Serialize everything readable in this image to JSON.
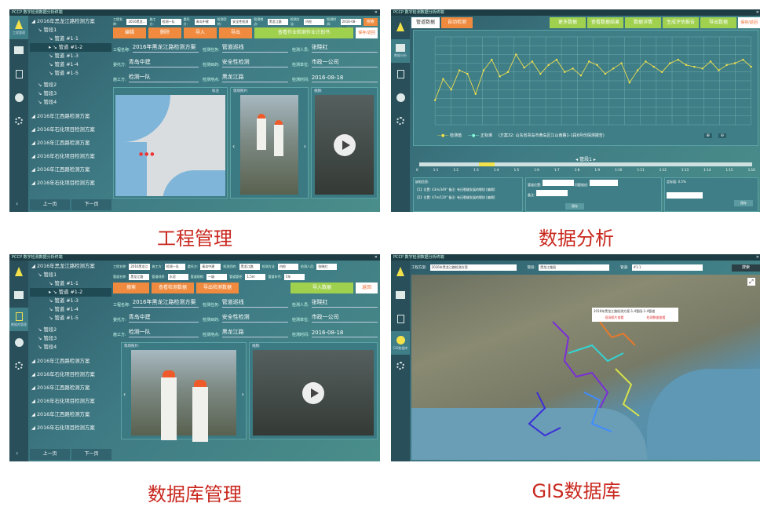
{
  "app_title": "PCCP 数字检测数据分析终端",
  "panels": {
    "p1": {
      "caption": "工程管理",
      "nav_label": "工程管理",
      "tree": {
        "root": "2016年黑龙江路检测方案",
        "seg": "管段1",
        "pipes": [
          "管道 #1-1",
          "管道 #1-2",
          "管道 #1-3",
          "管道 #1-4",
          "管道 #1-5"
        ],
        "segs": [
          "管段2",
          "管段3",
          "管段4"
        ],
        "projects": [
          "2016年江西路检测方案",
          "2016年石化项目检测方案",
          "2016年江西路检测方案",
          "2016年石化项目检测方案",
          "2016年江西路检测方案",
          "2016年石化项目检测方案"
        ]
      },
      "pager": {
        "prev": "上一页",
        "next": "下一页"
      },
      "filters": [
        "工程名称:",
        "2016黑龙...",
        "施工方:",
        "检测一队",
        "委托方:",
        "青岛中建",
        "检测目的:",
        "安全性检测",
        "检测地点:",
        "黑龙江路",
        "检测方法:",
        "内检",
        "检测时间:",
        "2016-08-18"
      ],
      "search": "搜索",
      "buttons": [
        "编辑",
        "删除",
        "导入",
        "导出"
      ],
      "green_button": "查看作业检测作业计划书",
      "white_button": "保存/返回",
      "info": [
        {
          "k": "工程名称:",
          "v": "2016年黑龙江路检测方案"
        },
        {
          "k": "检测任务:",
          "v": "管道巡线"
        },
        {
          "k": "检测人员:",
          "v": "张晓红"
        },
        {
          "k": "委托方:",
          "v": "青岛中建"
        },
        {
          "k": "检测目的:",
          "v": "安全性检测"
        },
        {
          "k": "检测单位:",
          "v": "市政一公司"
        },
        {
          "k": "施工方:",
          "v": "检测一队"
        },
        {
          "k": "检测地点:",
          "v": "黑龙江路"
        },
        {
          "k": "检测时间:",
          "v": "2016-08-18"
        }
      ],
      "media_labels": {
        "map": "标注",
        "photo": "现场照片:",
        "video": "视频:"
      }
    },
    "p2": {
      "caption": "数据分析",
      "nav_label": "数据分析",
      "top_select": "管道数据",
      "top_btn": "自动检测",
      "buttons": [
        "更多数据",
        "查看数据结果",
        "数据详情",
        "生成评估报告",
        "导出数据"
      ],
      "white_button": "保存/返回",
      "chart_note": "(方案32: 山东省青岛市黄岛区江山南路1-1段8月份探测报告)",
      "legend": [
        "检测值",
        "正标准"
      ],
      "segment_label": "管段1",
      "ticks": [
        "0",
        "1-1",
        "1-2",
        "1-3",
        "1-4",
        "1-5",
        "1-6",
        "1-7",
        "1-8",
        "1-9",
        "1-10",
        "1-11",
        "1-12",
        "1-13",
        "1-14",
        "1-15",
        "1-16"
      ],
      "bottom": {
        "left_title": "缺陷信息:",
        "left_rows": [
          "【1】位置: 43m/349°  备注: 有压裂缝发展的裂纹  [编辑]",
          "【2】位置: 47m/120°  备注: 有压裂缝发展的裂纹  [编辑]"
        ],
        "mid_labels": [
          "管道位置:",
          "问题描述:",
          "备注:"
        ],
        "mid_btn": "保存",
        "right_label": "定标值: 0.5%",
        "right_btn": "保存"
      }
    },
    "p3": {
      "caption": "数据库管理",
      "nav_label": "数据库管理",
      "buttons": [
        "搜索",
        "查看检测数据",
        "导出检测数据"
      ],
      "green_button": "导入数据",
      "white_button": "返回",
      "filters": [
        "工程名称:",
        "2016黑龙江",
        "施工方:",
        "检测一队",
        "委托方:",
        "青岛中建",
        "检测目的:",
        "黑龙江路",
        "检测方法:",
        "内检",
        "检测人员:",
        "张晓红",
        "管道名称:",
        "黑龙江路",
        "管道材质:",
        "水泥",
        "管道规格:",
        "一级",
        "管道管径:",
        "1.5m",
        "管道年代:",
        "5年"
      ],
      "info": [
        {
          "k": "工程名称:",
          "v": "2016年黑龙江路检测方案"
        },
        {
          "k": "检测任务:",
          "v": "管道巡线"
        },
        {
          "k": "检测人员:",
          "v": "张晓红"
        },
        {
          "k": "委托方:",
          "v": "青岛中建"
        },
        {
          "k": "检测目的:",
          "v": "安全性检测"
        },
        {
          "k": "检测单位:",
          "v": "市政一公司"
        },
        {
          "k": "施工方:",
          "v": "检测一队"
        },
        {
          "k": "检测地点:",
          "v": "黑龙江路"
        },
        {
          "k": "检测时间:",
          "v": "2016-08-18"
        }
      ],
      "media_labels": {
        "photo": "现场照片:",
        "video": "视频:"
      }
    },
    "p4": {
      "caption": "GIS数据库",
      "nav_label": "GIS数据库",
      "bar": [
        "工程方案:",
        "2016年黑龙江路检测方案",
        "管段:",
        "黑龙江路段",
        "管道:",
        "#1-1"
      ],
      "search": "搜索",
      "popup": [
        "2016年黑龙江路检测方案-1-4管段-1-4管道",
        "现场照片查看",
        "检测数据查看"
      ]
    }
  },
  "chart_data": {
    "type": "line",
    "title": "",
    "xlabel": "",
    "ylabel": "",
    "ylim": [
      0,
      100
    ],
    "series": [
      {
        "name": "检测值",
        "values": [
          28,
          52,
          40,
          62,
          58,
          35,
          62,
          74,
          55,
          60,
          80,
          65,
          72,
          58,
          68,
          74,
          60,
          64,
          56,
          72,
          68,
          58,
          64,
          70,
          48,
          62,
          72,
          66,
          60,
          70,
          74,
          68,
          66,
          64,
          72,
          62,
          68,
          70,
          74,
          66
        ]
      }
    ]
  },
  "colors": {
    "accent": "#ef8a3e",
    "green": "#9fd04e",
    "panel": "#3e7a84",
    "caption": "#c8281e"
  }
}
